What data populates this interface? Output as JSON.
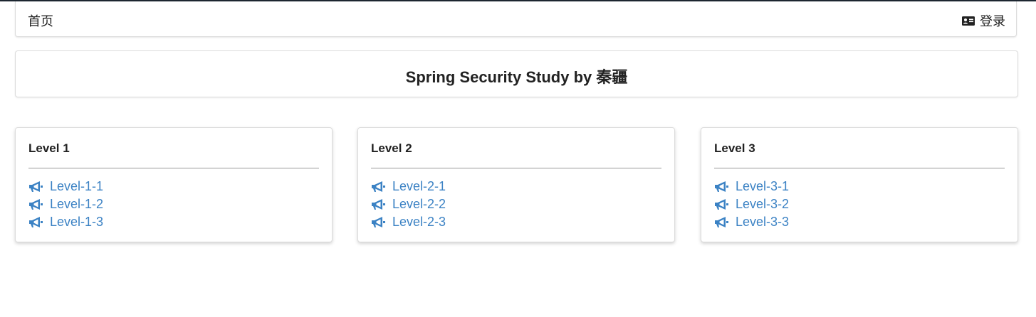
{
  "menu": {
    "home_label": "首页",
    "login_label": "登录",
    "login_icon": "id-card-icon"
  },
  "header": {
    "title": "Spring Security Study by 秦疆"
  },
  "colors": {
    "link": "#3b82c4",
    "text": "#222222",
    "top_border": "#1c2630"
  },
  "cards": [
    {
      "title": "Level 1",
      "icon": "bullhorn-icon",
      "links": [
        "Level-1-1",
        "Level-1-2",
        "Level-1-3"
      ]
    },
    {
      "title": "Level 2",
      "icon": "bullhorn-icon",
      "links": [
        "Level-2-1",
        "Level-2-2",
        "Level-2-3"
      ]
    },
    {
      "title": "Level 3",
      "icon": "bullhorn-icon",
      "links": [
        "Level-3-1",
        "Level-3-2",
        "Level-3-3"
      ]
    }
  ]
}
